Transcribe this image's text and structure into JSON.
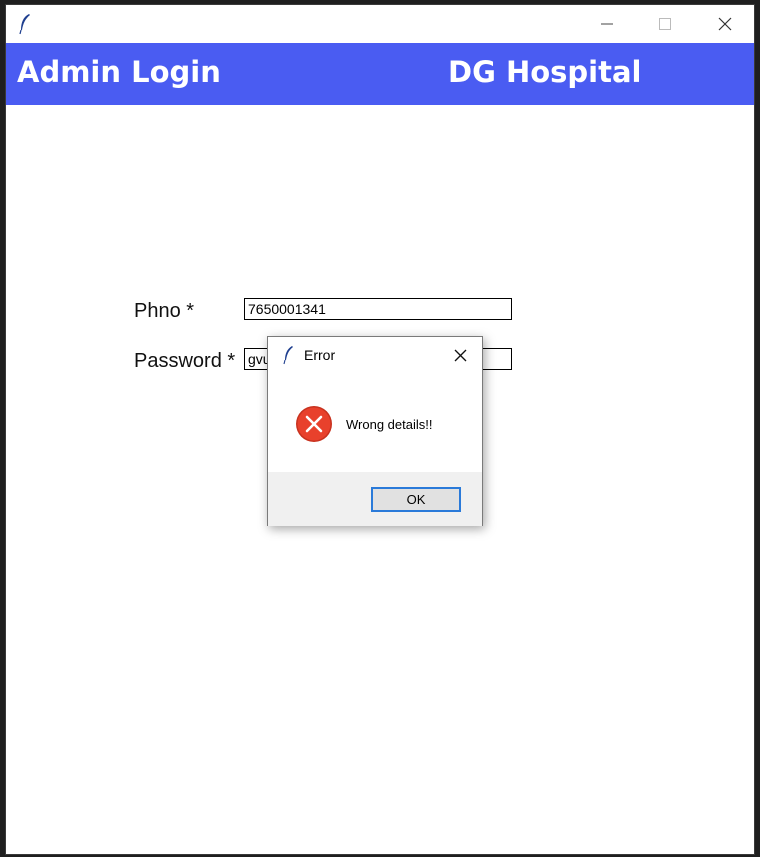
{
  "window": {
    "icon": "feather-icon",
    "controls": [
      "minimize-icon",
      "maximize-icon",
      "close-icon"
    ]
  },
  "banner": {
    "title_left": "Admin Login",
    "title_right": "DG Hospital",
    "color": "#4a5cf2"
  },
  "form": {
    "phno_label": "Phno *",
    "phno_value": "7650001341",
    "password_label": "Password *",
    "password_value": "gvu"
  },
  "dialog": {
    "title": "Error",
    "message": "Wrong details!!",
    "ok_label": "OK",
    "icon": "error-icon",
    "error_color": "#e8412c"
  }
}
